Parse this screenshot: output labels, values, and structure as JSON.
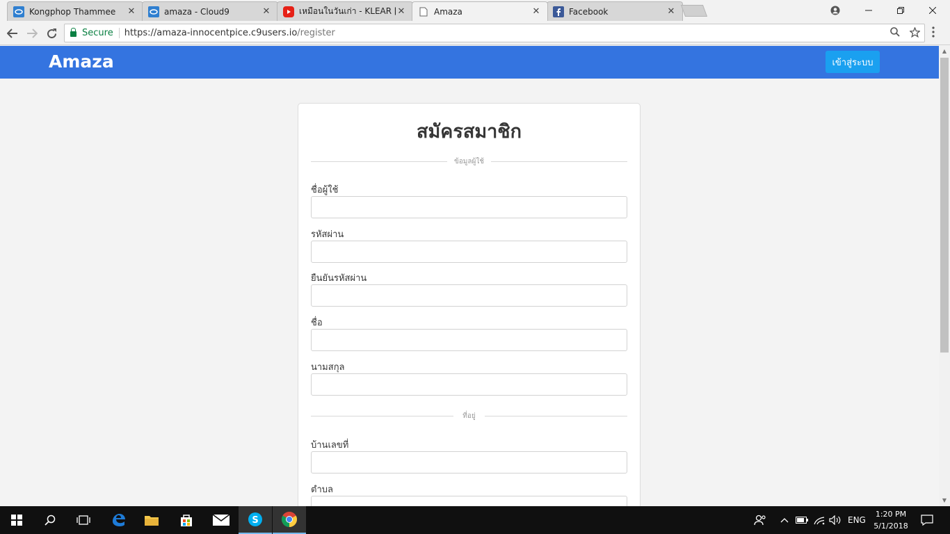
{
  "browser": {
    "tabs": [
      {
        "title": "Kongphop Thammee",
        "icon": "cloud9-icon"
      },
      {
        "title": "amaza - Cloud9",
        "icon": "cloud9-icon"
      },
      {
        "title": "เหมือนในวันเก่า - KLEAR [Of",
        "icon": "youtube-icon"
      },
      {
        "title": "Amaza",
        "icon": "page-icon"
      },
      {
        "title": "Facebook",
        "icon": "facebook-icon"
      }
    ],
    "close_glyph": "✕",
    "secure_label": "Secure",
    "url_host": "https://amaza-innocentpice.c9users.io",
    "url_path": "/register"
  },
  "header": {
    "brand": "Amaza",
    "login_label": "เข้าสู่ระบบ"
  },
  "form": {
    "title": "สมัครสมาชิก",
    "section_account": "ข้อมูลผู้ใช้",
    "username_label": "ชื่อผู้ใช้",
    "password_label": "รหัสผ่าน",
    "confirm_password_label": "ยืนยันรหัสผ่าน",
    "firstname_label": "ชื่อ",
    "lastname_label": "นามสกุล",
    "section_address": "ที่อยู่",
    "house_number_label": "บ้านเลขที่",
    "subdistrict_label": "ตำบล"
  },
  "taskbar": {
    "language": "ENG",
    "time": "1:20 PM",
    "date": "5/1/2018"
  },
  "colors": {
    "header_bg": "#3474e0",
    "button_bg": "#1aa0f0",
    "secure_green": "#0b8043"
  }
}
